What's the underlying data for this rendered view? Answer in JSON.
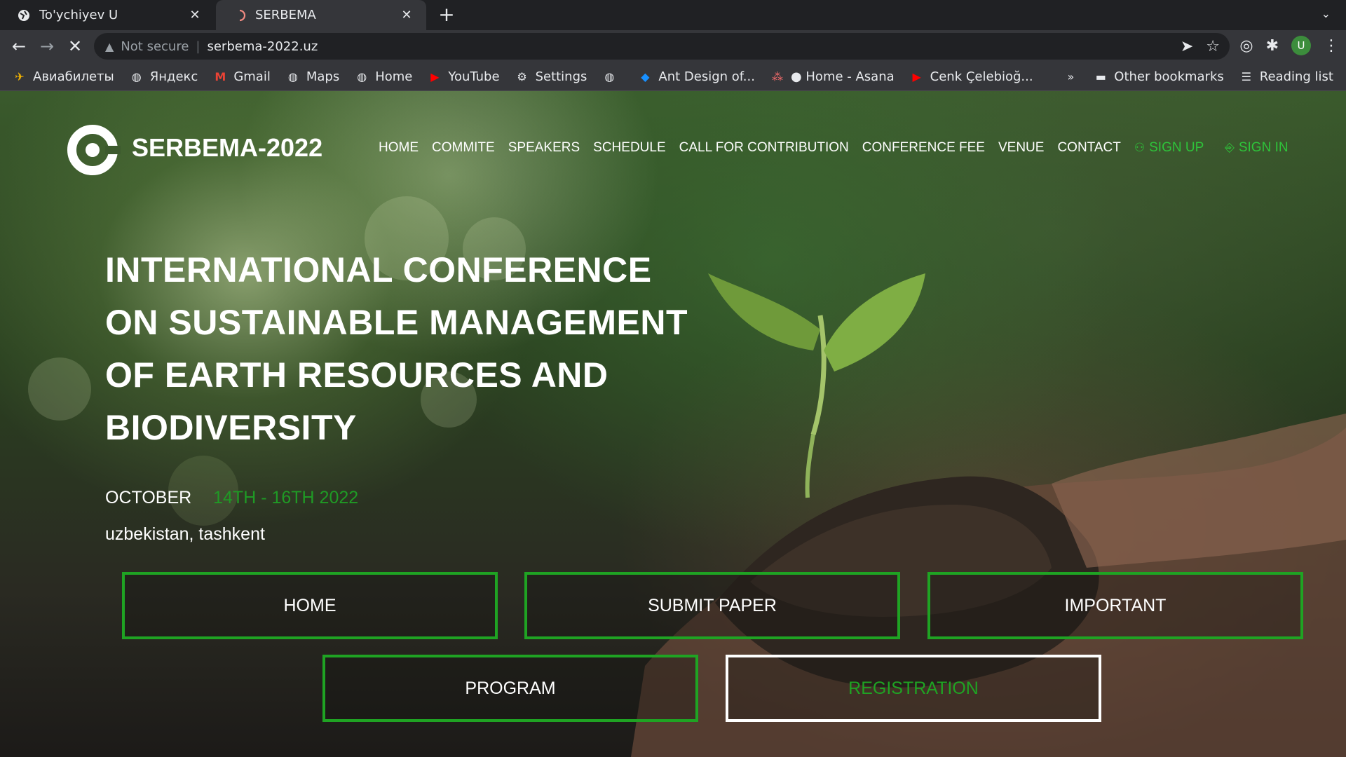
{
  "browser": {
    "tabs": [
      {
        "title": "To'ychiyev U",
        "active": false
      },
      {
        "title": "SERBEMA",
        "active": true
      }
    ],
    "omnibox": {
      "security_label": "Not secure",
      "url": "serbema-2022.uz"
    },
    "bookmarks": [
      {
        "label": "Авиабилеты",
        "icon": "plane-icon"
      },
      {
        "label": "Яндекс",
        "icon": "globe-icon"
      },
      {
        "label": "Gmail",
        "icon": "gmail-icon"
      },
      {
        "label": "Maps",
        "icon": "globe-icon"
      },
      {
        "label": "Home",
        "icon": "globe-icon"
      },
      {
        "label": "YouTube",
        "icon": "youtube-icon"
      },
      {
        "label": "Settings",
        "icon": "gear-icon"
      },
      {
        "label": "",
        "icon": "globe-icon"
      },
      {
        "label": "Ant Design of...",
        "icon": "ant-design-icon"
      },
      {
        "label": "● Home - Asana",
        "icon": "asana-icon"
      },
      {
        "label": "Cenk Çelebioğ...",
        "icon": "youtube-icon"
      }
    ],
    "overflow": "»",
    "other_bookmarks": "Other bookmarks",
    "reading_list": "Reading list",
    "profile_initial": "U"
  },
  "site": {
    "title": "SERBEMA-2022",
    "nav": {
      "home": "HOME",
      "commite": "COMMITE",
      "speakers": "SPEAKERS",
      "schedule": "SCHEDULE",
      "call": "CALL FOR CONTRIBUTION",
      "fee": "CONFERENCE FEE",
      "venue": "VENUE",
      "contact": "CONTACT",
      "sign_up": "SIGN UP",
      "sign_in": "SIGN IN"
    },
    "hero": {
      "line1": "INTERNATIONAL CONFERENCE",
      "line2": "ON SUSTAINABLE MANAGEMENT",
      "line3": "OF EARTH RESOURCES AND",
      "line4": "BIODIVERSITY",
      "month": "OCTOBER",
      "dates": "14TH - 16TH 2022",
      "location": "uzbekistan, tashkent"
    },
    "buttons": {
      "home": "HOME",
      "submit": "SUBMIT PAPER",
      "important": "IMPORTANT",
      "program": "PROGRAM",
      "registration": "REGISTRATION"
    }
  },
  "colors": {
    "accent_green": "#1fa323",
    "auth_green": "#2ec43a",
    "chrome_dark": "#202124",
    "chrome_mid": "#35363a"
  }
}
